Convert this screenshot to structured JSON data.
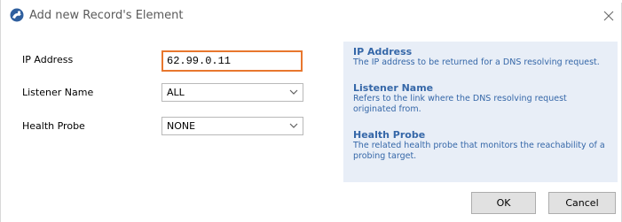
{
  "window": {
    "title": "Add new Record's Element",
    "icon": "app-globe-icon",
    "close_icon": "close-icon"
  },
  "form": {
    "ip_address": {
      "label": "IP Address",
      "value": "62.99.0.11"
    },
    "listener_name": {
      "label": "Listener Name",
      "selected": "ALL"
    },
    "health_probe": {
      "label": "Health Probe",
      "selected": "NONE"
    }
  },
  "help": {
    "items": [
      {
        "title": "IP Address",
        "text": "The IP address to be returned for a DNS resolving request."
      },
      {
        "title": "Listener Name",
        "text_lines": [
          "Refers to the link where the DNS resolving request",
          "originated from."
        ]
      },
      {
        "title": "Health Probe",
        "text_lines": [
          "The related health probe that monitors the reachability of a",
          "probing target."
        ]
      }
    ]
  },
  "buttons": {
    "ok": "OK",
    "cancel": "Cancel"
  },
  "colors": {
    "focus_border": "#e8772e",
    "help_background": "#e8eef7",
    "help_text": "#3567a8",
    "app_icon": "#2f5f9e"
  }
}
